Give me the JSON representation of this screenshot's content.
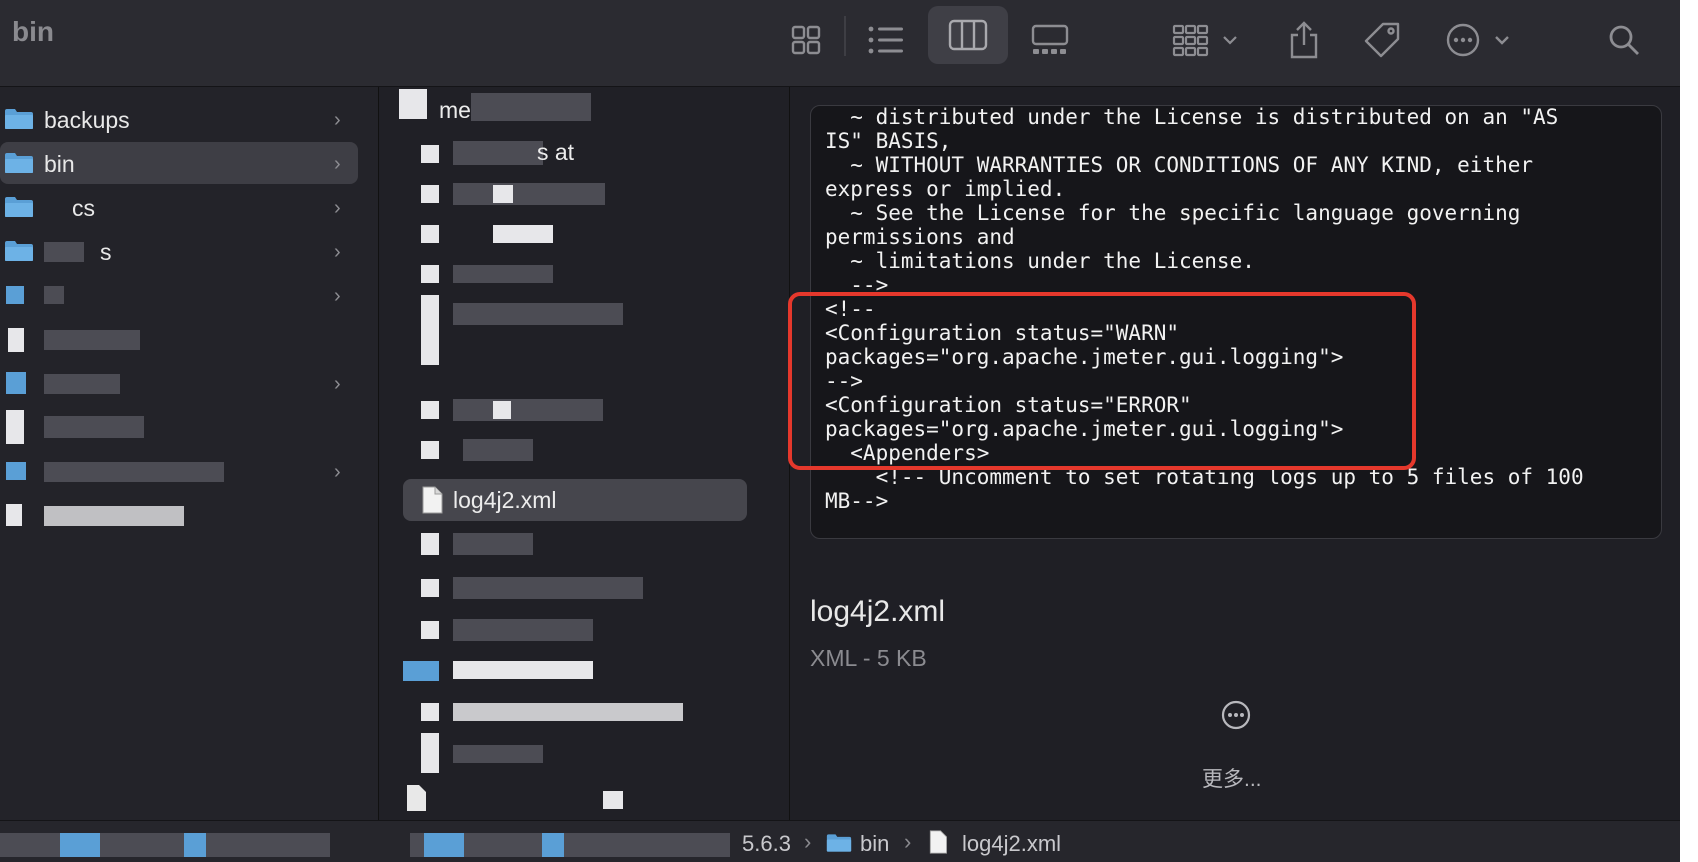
{
  "window": {
    "title": "bin"
  },
  "toolbar": {
    "icons": [
      "grid-view-icon",
      "list-view-icon",
      "column-view-icon",
      "gallery-view-icon",
      "group-icon",
      "share-icon",
      "tag-icon",
      "more-actions-icon",
      "search-icon"
    ],
    "active_view": "column-view"
  },
  "sidebar": {
    "items": [
      {
        "label": "backups",
        "has_chevron": true
      },
      {
        "label": "bin",
        "has_chevron": true,
        "selected": true
      },
      {
        "label": "cs",
        "has_chevron": true
      },
      {
        "label": "s",
        "has_chevron": true
      }
    ]
  },
  "files": {
    "first_label": "me",
    "second_label": "s    at",
    "selected_label": "log4j2.xml"
  },
  "preview": {
    "code_lines": [
      "  ~ distributed under the License is distributed on an \"AS",
      "IS\" BASIS,",
      "  ~ WITHOUT WARRANTIES OR CONDITIONS OF ANY KIND, either",
      "express or implied.",
      "  ~ See the License for the specific language governing",
      "permissions and",
      "  ~ limitations under the License.",
      "  -->",
      "<!--",
      "<Configuration status=\"WARN\"",
      "packages=\"org.apache.jmeter.gui.logging\">",
      "-->",
      "<Configuration status=\"ERROR\"",
      "packages=\"org.apache.jmeter.gui.logging\">",
      "  <Appenders>",
      "    <!-- Uncomment to set rotating logs up to 5 files of 100",
      "MB-->"
    ],
    "file_name": "log4j2.xml",
    "file_meta": "XML - 5 KB",
    "more_label": "更多..."
  },
  "pathbar": {
    "crumbs": [
      "5.6.3",
      "bin",
      "log4j2.xml"
    ]
  },
  "colors": {
    "highlight_border": "#e5382c",
    "folder_blue": "#5a9fd6",
    "background": "#1f1f25"
  }
}
